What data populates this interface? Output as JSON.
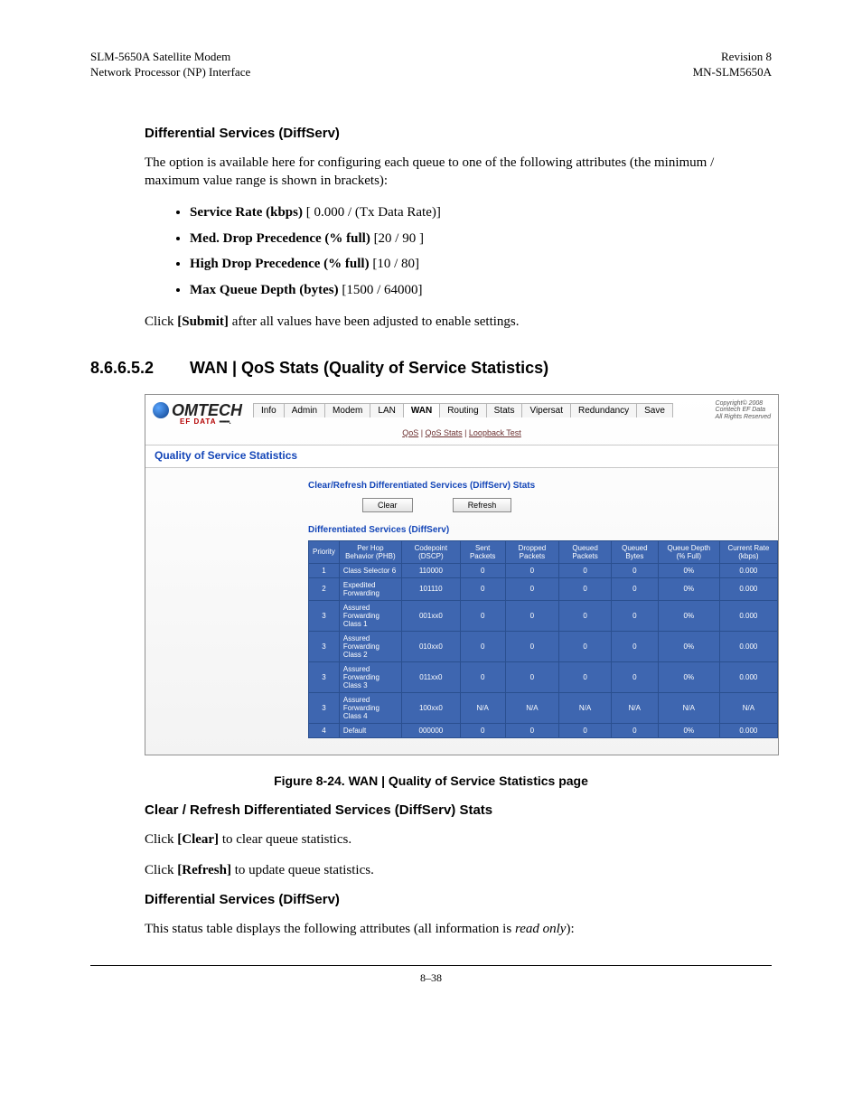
{
  "header": {
    "left1": "SLM-5650A Satellite Modem",
    "left2": "Network Processor (NP) Interface",
    "right1": "Revision 8",
    "right2": "MN-SLM5650A"
  },
  "diffserv1": {
    "heading": "Differential Services (DiffServ)",
    "intro": "The option is available here for configuring each queue to one of the following attributes (the minimum / maximum value range is shown in brackets):",
    "items": [
      {
        "b": "Service Rate (kbps)",
        "rest": " [ 0.000 / (Tx Data Rate)]"
      },
      {
        "b": "Med. Drop Precedence (% full)",
        "rest": " [20 / 90 ]"
      },
      {
        "b": "High Drop Precedence (% full)",
        "rest": " [10 / 80]"
      },
      {
        "b": "Max Queue Depth (bytes)",
        "rest": " [1500 / 64000]"
      }
    ],
    "submit_pre": "Click ",
    "submit_bold": "[Submit]",
    "submit_post": " after all values have been adjusted to enable settings."
  },
  "section": {
    "num": "8.6.6.5.2",
    "title": "WAN | QoS Stats (Quality of Service Statistics)"
  },
  "shot": {
    "logo": "OMTECH",
    "efdata": "EF DATA",
    "tabs": [
      "Info",
      "Admin",
      "Modem",
      "LAN",
      "WAN",
      "Routing",
      "Stats",
      "Vipersat",
      "Redundancy",
      "Save"
    ],
    "active_tab": "WAN",
    "copyright1": "Copyright© 2008",
    "copyright2": "Comtech EF Data",
    "copyright3": "All Rights Reserved",
    "subnav": [
      "QoS",
      "QoS Stats",
      "Loopback Test"
    ],
    "panel_title": "Quality of Service Statistics",
    "group1": "Clear/Refresh Differentiated Services (DiffServ) Stats",
    "btn_clear": "Clear",
    "btn_refresh": "Refresh",
    "group2": "Differentiated Services (DiffServ)",
    "cols": [
      "Priority",
      "Per Hop Behavior (PHB)",
      "Codepoint (DSCP)",
      "Sent Packets",
      "Dropped Packets",
      "Queued Packets",
      "Queued Bytes",
      "Queue Depth (% Full)",
      "Current Rate (kbps)"
    ],
    "rows": [
      {
        "p": "1",
        "phb": "Class Selector 6",
        "dscp": "110000",
        "sent": "0",
        "drop": "0",
        "qp": "0",
        "qb": "0",
        "qd": "0%",
        "cr": "0.000"
      },
      {
        "p": "2",
        "phb": "Expedited Forwarding",
        "dscp": "101110",
        "sent": "0",
        "drop": "0",
        "qp": "0",
        "qb": "0",
        "qd": "0%",
        "cr": "0.000"
      },
      {
        "p": "3",
        "phb": "Assured Forwarding Class 1",
        "dscp": "001xx0",
        "sent": "0",
        "drop": "0",
        "qp": "0",
        "qb": "0",
        "qd": "0%",
        "cr": "0.000"
      },
      {
        "p": "3",
        "phb": "Assured Forwarding Class 2",
        "dscp": "010xx0",
        "sent": "0",
        "drop": "0",
        "qp": "0",
        "qb": "0",
        "qd": "0%",
        "cr": "0.000"
      },
      {
        "p": "3",
        "phb": "Assured Forwarding Class 3",
        "dscp": "011xx0",
        "sent": "0",
        "drop": "0",
        "qp": "0",
        "qb": "0",
        "qd": "0%",
        "cr": "0.000"
      },
      {
        "p": "3",
        "phb": "Assured Forwarding Class 4",
        "dscp": "100xx0",
        "sent": "N/A",
        "drop": "N/A",
        "qp": "N/A",
        "qb": "N/A",
        "qd": "N/A",
        "cr": "N/A"
      },
      {
        "p": "4",
        "phb": "Default",
        "dscp": "000000",
        "sent": "0",
        "drop": "0",
        "qp": "0",
        "qb": "0",
        "qd": "0%",
        "cr": "0.000"
      }
    ]
  },
  "figcap": "Figure 8-24. WAN | Quality of Service Statistics page",
  "clear_refresh": {
    "heading": "Clear / Refresh Differentiated Services (DiffServ) Stats",
    "line1_pre": "Click ",
    "line1_bold": "[Clear]",
    "line1_post": " to clear queue statistics.",
    "line2_pre": "Click ",
    "line2_bold": "[Refresh]",
    "line2_post": " to update queue statistics."
  },
  "diffserv2": {
    "heading": "Differential Services (DiffServ)",
    "line_pre": "This status table displays the following attributes (all information is ",
    "line_em": "read only",
    "line_post": "):"
  },
  "pagenum": "8–38"
}
